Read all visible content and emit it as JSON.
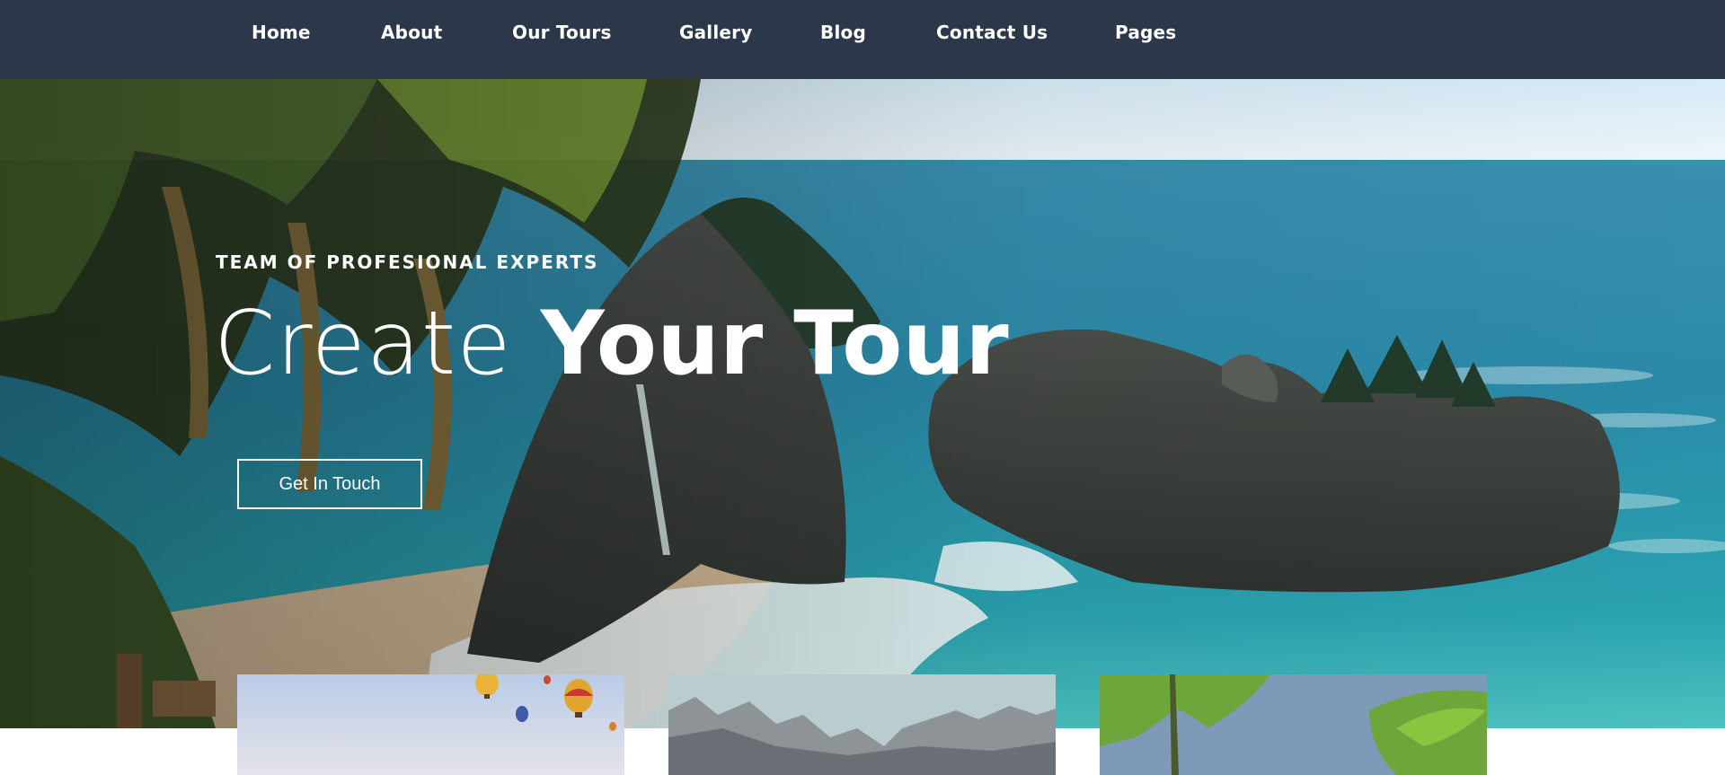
{
  "nav": {
    "items": [
      {
        "label": "Home"
      },
      {
        "label": "About"
      },
      {
        "label": "Our Tours"
      },
      {
        "label": "Gallery"
      },
      {
        "label": "Blog"
      },
      {
        "label": "Contact Us"
      },
      {
        "label": "Pages"
      }
    ]
  },
  "hero": {
    "kicker": "TEAM OF PROFESIONAL EXPERTS",
    "title_light": "Create ",
    "title_bold": "Your Tour",
    "cta_label": "Get In Touch",
    "image": "coastal-cliff-beach-photo"
  },
  "cards": [
    {
      "image": "hot-air-balloons-photo"
    },
    {
      "image": "rocky-mountains-photo"
    },
    {
      "image": "palm-trees-photo"
    }
  ],
  "colors": {
    "nav_bg": "#2d374a",
    "text": "#ffffff",
    "sea": "#268fa9"
  }
}
